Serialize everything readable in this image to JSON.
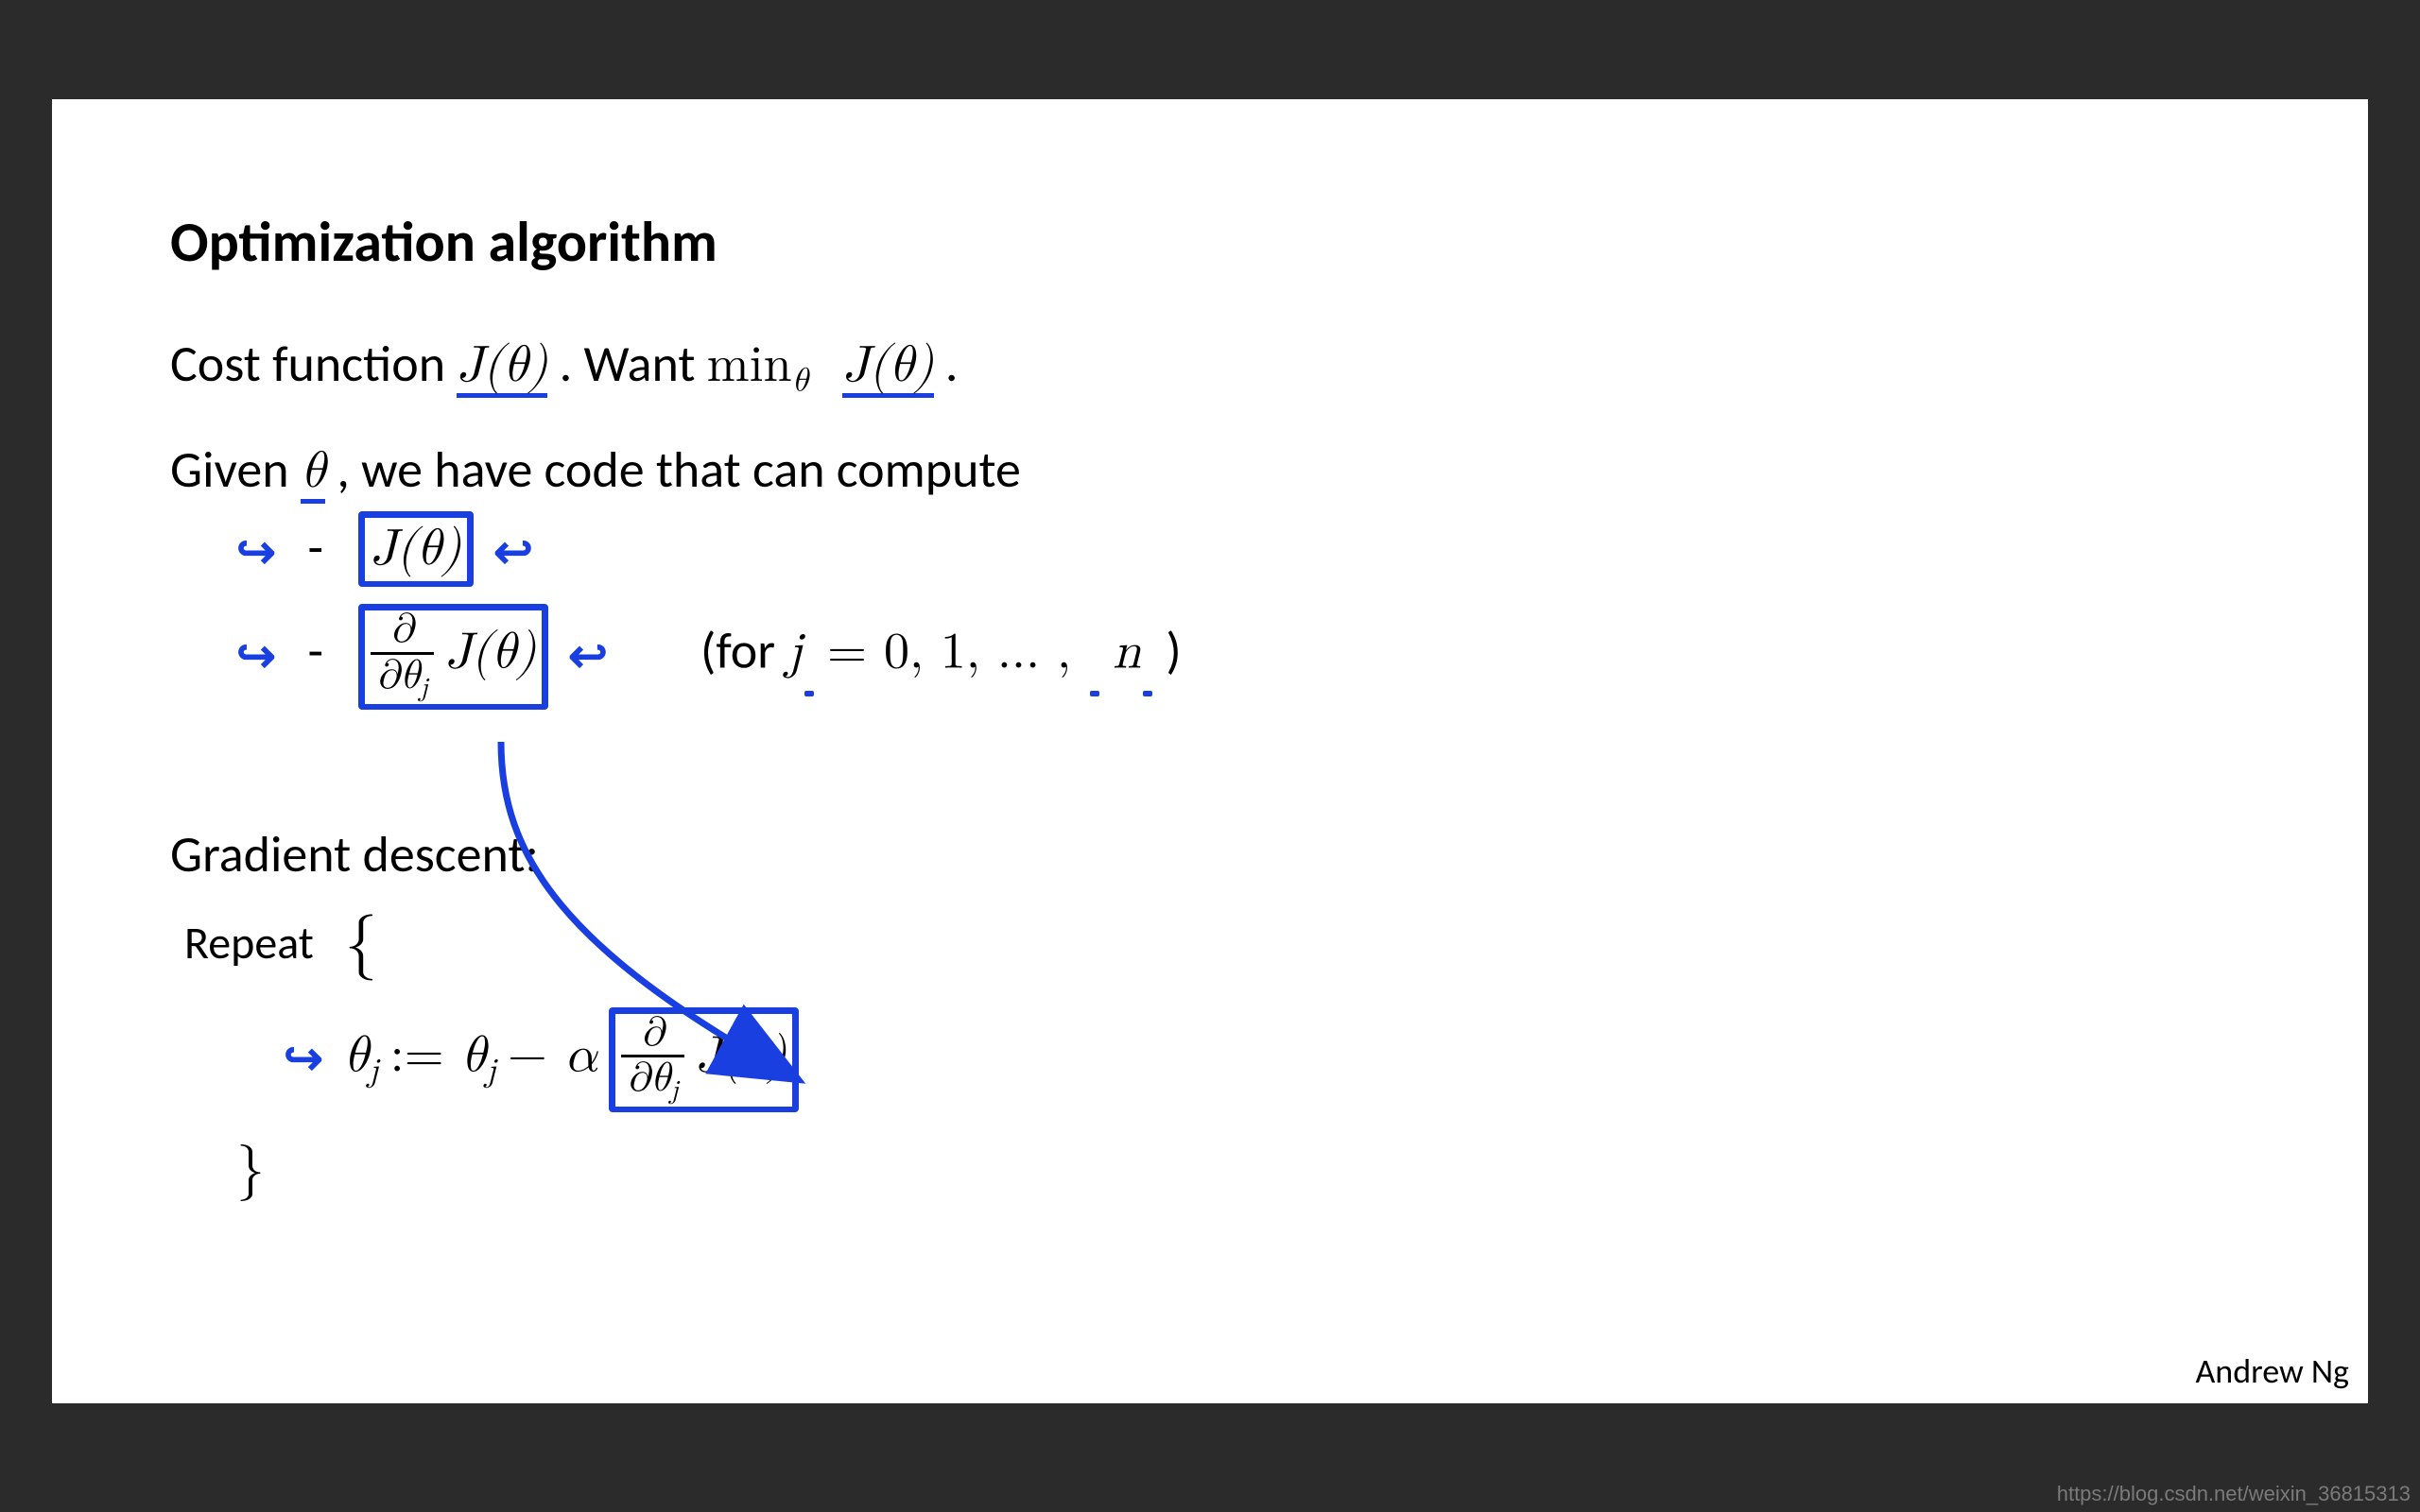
{
  "slide": {
    "title": "Optimization algorithm",
    "line1": {
      "pre": "Cost function ",
      "J1": "J(θ)",
      "mid": ". Want ",
      "min": "min",
      "minsub": "θ",
      "J2": "J(θ)",
      "post": " ."
    },
    "line2": {
      "pre": "Given ",
      "theta": "θ",
      "post": ", we have code that can compute"
    },
    "bullet1": {
      "dash": "-",
      "expr": "J(θ)"
    },
    "bullet2": {
      "dash": "-",
      "frac_num": "∂",
      "frac_den_a": "∂θ",
      "frac_den_sub": "j",
      "Jpart": "J(θ)",
      "for_open": "(for ",
      "j": "j",
      "eq": " = 0, 1, … , ",
      "n": "n",
      "for_close": " )"
    },
    "gd_head": "Gradient descent:",
    "repeat": "Repeat",
    "lbrace": "{",
    "update": {
      "thetaj1": "θ",
      "sub1": "j",
      "assign": " := ",
      "thetaj2": "θ",
      "sub2": "j",
      "minus": " − ",
      "alpha": "α",
      "frac_num": "∂",
      "frac_den_a": "∂θ",
      "frac_den_sub": "j",
      "Jpart": "J(θ)"
    },
    "rbrace": "}",
    "author": "Andrew Ng",
    "watermark": "https://blog.csdn.net/weixin_36815313"
  }
}
